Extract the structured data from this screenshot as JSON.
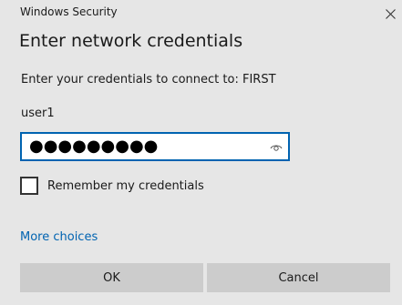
{
  "window": {
    "title": "Windows Security"
  },
  "dialog": {
    "heading": "Enter network credentials",
    "prompt": "Enter your credentials to connect to: FIRST",
    "username": "user1",
    "password_mask": "●●●●●●●●●",
    "remember_label": "Remember my credentials",
    "remember_checked": false,
    "more_choices_label": "More choices"
  },
  "buttons": {
    "ok_label": "OK",
    "cancel_label": "Cancel"
  },
  "colors": {
    "background": "#e6e6e6",
    "accent": "#0063b1",
    "button_bg": "#cccccc",
    "text": "#1a1a1a"
  },
  "icons": {
    "close": "close-icon",
    "reveal": "eye-icon"
  }
}
